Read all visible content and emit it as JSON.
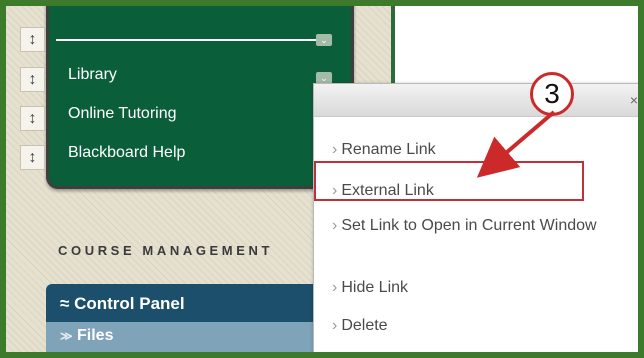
{
  "course_menu": {
    "items": [
      {
        "label": "Library"
      },
      {
        "label": "Online Tutoring"
      },
      {
        "label": "Blackboard Help"
      }
    ]
  },
  "course_management": {
    "heading": "COURSE MANAGEMENT",
    "control_panel": "Control Panel",
    "files": "Files"
  },
  "context_menu": {
    "close_glyph": "×",
    "items": [
      {
        "label": "Rename Link"
      },
      {
        "label": "External Link"
      },
      {
        "label": "Set Link to Open in Current Window"
      },
      {
        "label": "Hide Link"
      },
      {
        "label": "Delete"
      }
    ]
  },
  "annotation": {
    "step_number": "3"
  },
  "colors": {
    "frame_border": "#3e7a2c",
    "menu_bg": "#0b5e3a",
    "control_panel_bg": "#1b4f6b",
    "highlight": "#c0303a"
  }
}
